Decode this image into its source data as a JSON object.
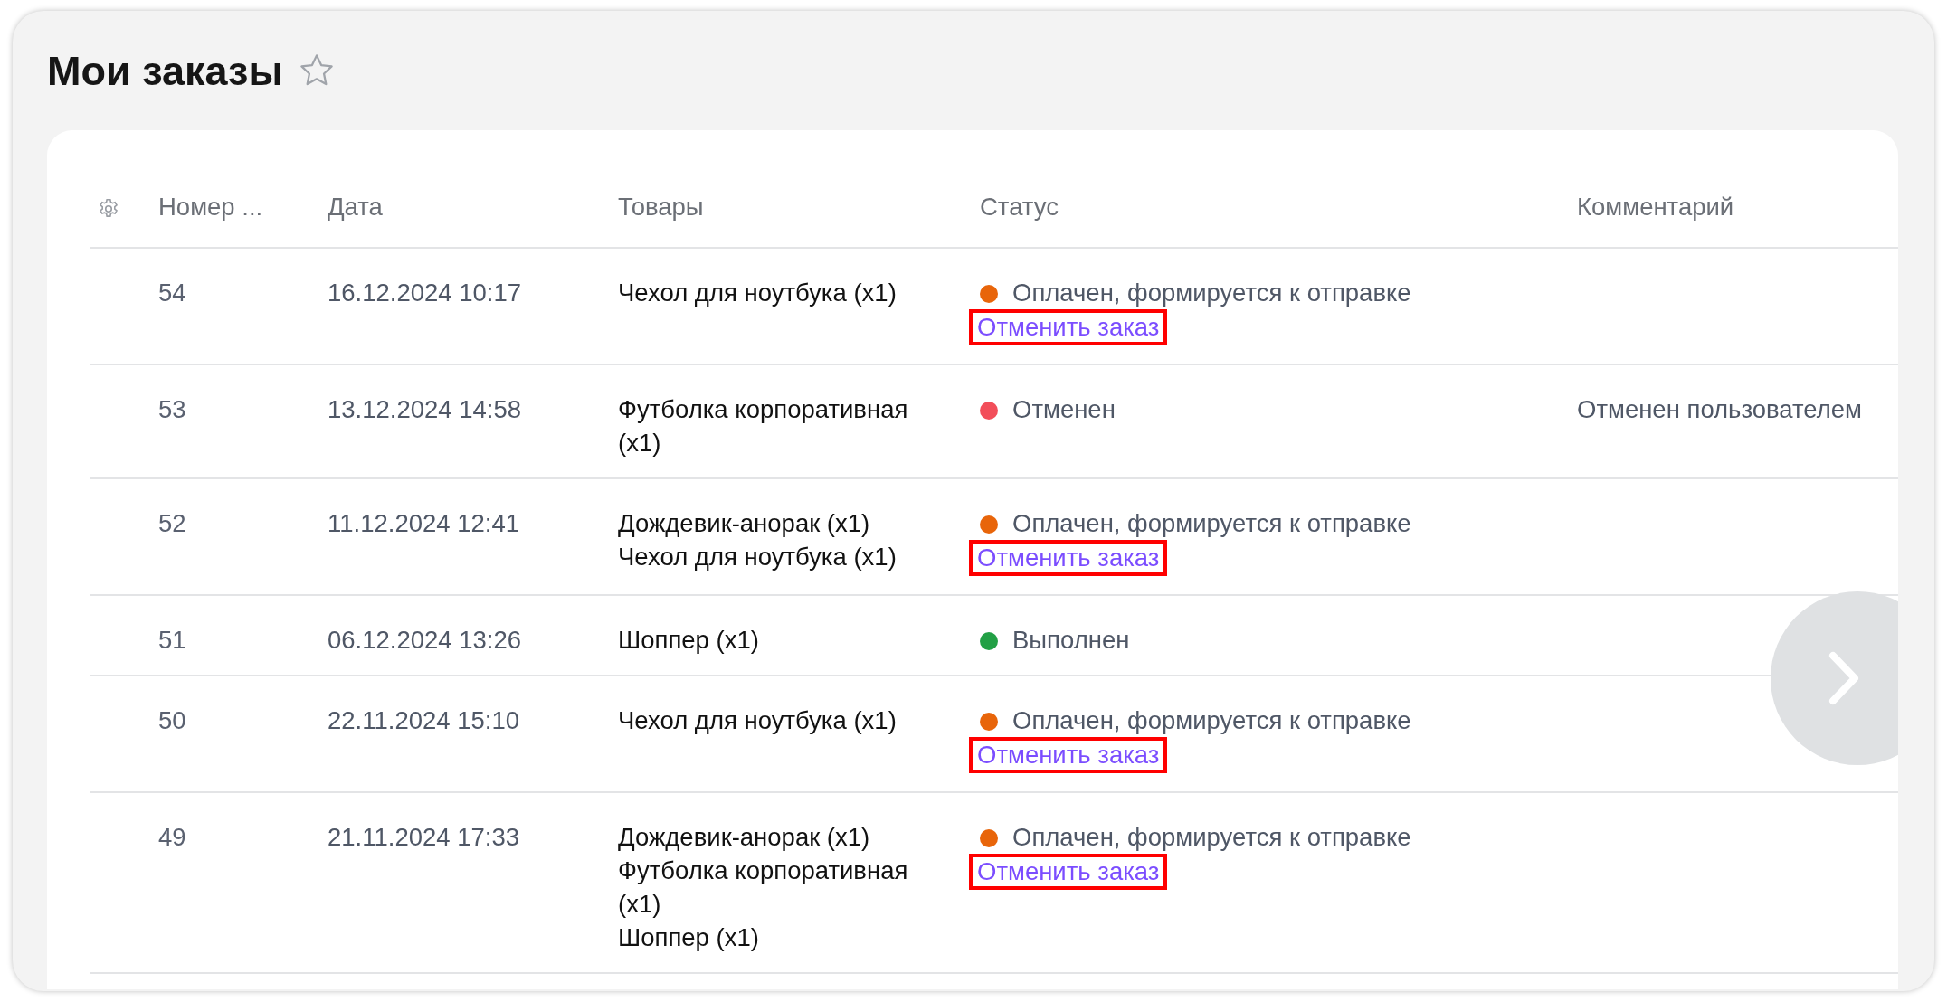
{
  "page": {
    "title": "Мои заказы",
    "favorite": false
  },
  "table": {
    "columns": [
      "Номер ...",
      "Дата",
      "Товары",
      "Статус",
      "Комментарий"
    ],
    "rows": [
      {
        "number": "54",
        "date": "16.12.2024 10:17",
        "items": [
          "Чехол для ноутбука (x1)"
        ],
        "status": {
          "label": "Оплачен, формируется к отправке",
          "color": "#e8650a"
        },
        "cancel_link": {
          "label": "Отменить заказ",
          "highlighted": true
        }
      },
      {
        "number": "53",
        "date": "13.12.2024 14:58",
        "items": [
          "Футболка корпоративная (x1)"
        ],
        "status": {
          "label": "Отменен",
          "color": "#f24e5a"
        },
        "comment": "Отменен пользователем"
      },
      {
        "number": "52",
        "date": "11.12.2024 12:41",
        "items": [
          "Дождевик-анорак (x1)",
          "Чехол для ноутбука (x1)"
        ],
        "status": {
          "label": "Оплачен, формируется к отправке",
          "color": "#e8650a"
        },
        "cancel_link": {
          "label": "Отменить заказ",
          "highlighted": true
        }
      },
      {
        "number": "51",
        "date": "06.12.2024 13:26",
        "items": [
          "Шоппер (x1)"
        ],
        "status": {
          "label": "Выполнен",
          "color": "#22a045"
        }
      },
      {
        "number": "50",
        "date": "22.11.2024 15:10",
        "items": [
          "Чехол для ноутбука (x1)"
        ],
        "status": {
          "label": "Оплачен, формируется к отправке",
          "color": "#e8650a"
        },
        "cancel_link": {
          "label": "Отменить заказ",
          "highlighted": true
        }
      },
      {
        "number": "49",
        "date": "21.11.2024 17:33",
        "items": [
          "Дождевик-анорак (x1)",
          "Футболка корпоративная (x1)",
          "Шоппер (x1)"
        ],
        "status": {
          "label": "Оплачен, формируется к отправке",
          "color": "#e8650a"
        },
        "cancel_link": {
          "label": "Отменить заказ",
          "highlighted": true
        }
      }
    ]
  }
}
